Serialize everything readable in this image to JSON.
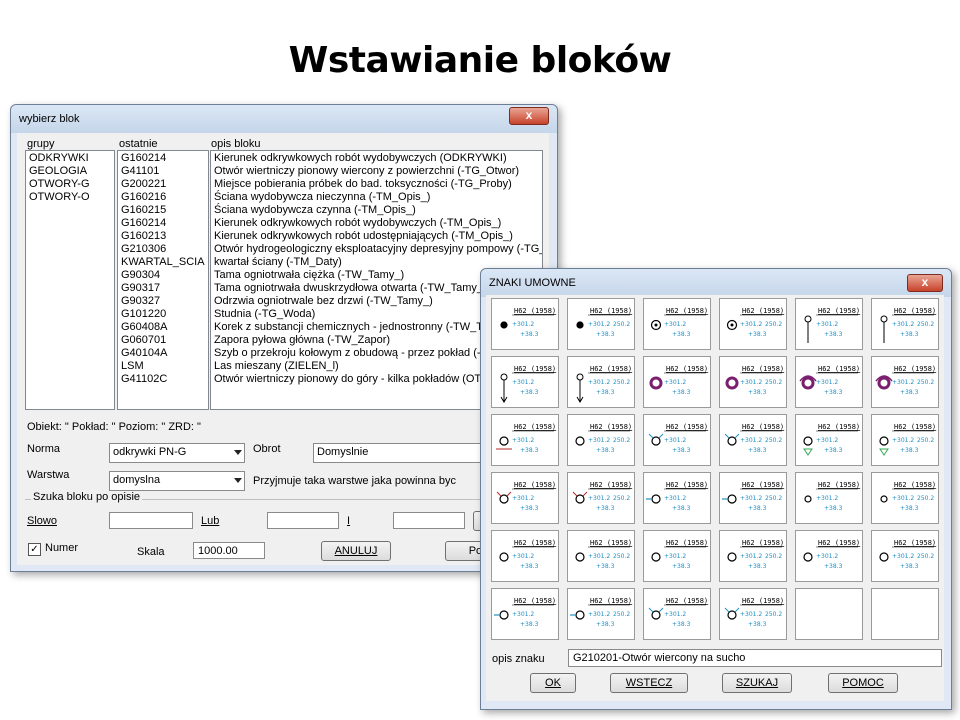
{
  "slide_title": "Wstawianie bloków",
  "win1": {
    "title": "wybierz blok",
    "close": "x",
    "col_headers": {
      "groups": "grupy",
      "recent": "ostatnie",
      "desc": "opis bloku"
    },
    "groups": [
      "ODKRYWKI",
      "GEOLOGIA",
      "OTWORY-G",
      "OTWORY-O"
    ],
    "recent": [
      "G160214",
      "G41101",
      "G200221",
      "G160216",
      "G160215",
      "G160214",
      "G160213",
      "G210306",
      "KWARTAL_SCIA",
      "G90304",
      "G90317",
      "G90327",
      "G101220",
      "G60408A",
      "G060701",
      "G40104A",
      "LSM",
      "G41102C"
    ],
    "descriptions": [
      "Kierunek odkrywkowych robót wydobywczych (ODKRYWKI)",
      "Otwór wiertniczy pionowy wiercony z powierzchni (-TG_Otwor)",
      "Miejsce pobierania próbek do bad. toksyczności (-TG_Proby)",
      "Ściana wydobywcza nieczynna (-TM_Opis_)",
      "Ściana wydobywcza czynna (-TM_Opis_)",
      "Kierunek odkrywkowych robót wydobywczych (-TM_Opis_)",
      "Kierunek odkrywkowych robót udostępniających (-TM_Opis_)",
      "Otwór hydrogeologiczny eksploatacyjny depresyjny pompowy (-TG_Ot",
      "kwartał ściany (-TM_Daty)",
      "Tama ogniotrwała  ciężka (-TW_Tamy_)",
      "Tama ogniotrwała dwuskrzydłowa otwarta (-TW_Tamy_)",
      "Odrzwia ogniotrwale bez drzwi (-TW_Tamy_)",
      "Studnia (-TG_Woda)",
      "Korek z substancji chemicznych - jednostronny (-TW_Tam",
      "Zapora pyłowa główna (-TW_Zapor)",
      "Szyb o przekroju kołowym z obudową - przez pokład (-T",
      "Las mieszany (ZIELEN_l)",
      "Otwór wiertniczy pionowy do góry - kilka pokładów (OTW"
    ],
    "info_line": "Obiekt: \"  Pokład: \"  Poziom: \"  ZRD: \"",
    "norma_label": "Norma",
    "norma_value": "odkrywki PN-G",
    "obrot_label": "Obrot",
    "obrot_value": "Domyslnie",
    "warstwa_label": "Warstwa",
    "warstwa_value": "domyslna",
    "warstwa_note": "Przyjmuje taka warstwe jaka powinna byc",
    "search_group": "Szuka bloku po opisie",
    "slowo_label": "Slowo",
    "lub_label": "Lub",
    "i_label": "I",
    "numer_label": "Numer",
    "numer_checked": "✓",
    "skala_label": "Skala",
    "skala_value": "1000.00",
    "anuluj_btn": "ANULUJ",
    "pomoc_btn": "Pom"
  },
  "win2": {
    "title": "ZNAKI UMOWNE",
    "close": "x",
    "sym_title": "H62 (1958)",
    "sym_v1": "+301.2",
    "sym_v2": "+38.3",
    "sym_v3": "250.2",
    "opis_label": "opis znaku",
    "opis_value": "G210201-Otwór wiercony na sucho",
    "ok_btn": "OK",
    "wstecz_btn": "WSTECZ",
    "szukaj_btn": "SZUKAJ",
    "pomoc_btn": "POMOC",
    "colors": {
      "value_blue": "#1f8fc4",
      "marker_purple": "#7a1f6e",
      "marker_green": "#34a853",
      "marker_red": "#b52a2a"
    }
  }
}
